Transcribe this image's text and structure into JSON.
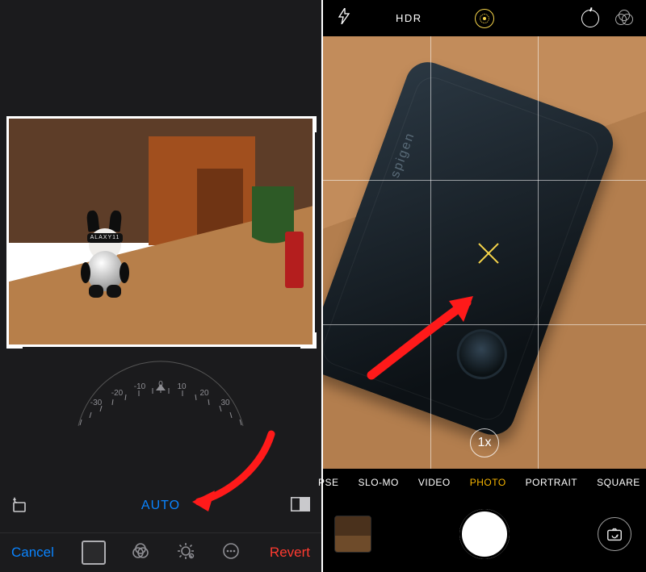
{
  "left": {
    "dial_labels": [
      "-30",
      "-20",
      "-10",
      "0",
      "10",
      "20",
      "30"
    ],
    "auto_label": "AUTO",
    "rotate_icon": "rotate-ccw-icon",
    "aspect_icon": "aspect-ratio-icon",
    "toolbar": {
      "cancel": "Cancel",
      "revert": "Revert",
      "tools": [
        "crop",
        "filters",
        "light",
        "more"
      ]
    },
    "photo_subject_text": "ALAXY11"
  },
  "right": {
    "topbar": {
      "flash": "auto",
      "hdr_label": "HDR",
      "live_photo": "on",
      "timer": "off",
      "filters": "off"
    },
    "zoom_label": "1x",
    "phone_brand": "spigen",
    "modes": {
      "items": [
        "PSE",
        "SLO-MO",
        "VIDEO",
        "PHOTO",
        "PORTRAIT",
        "SQUARE"
      ],
      "selected_index": 3
    },
    "shutter": "capture",
    "flip": "switch-camera"
  }
}
